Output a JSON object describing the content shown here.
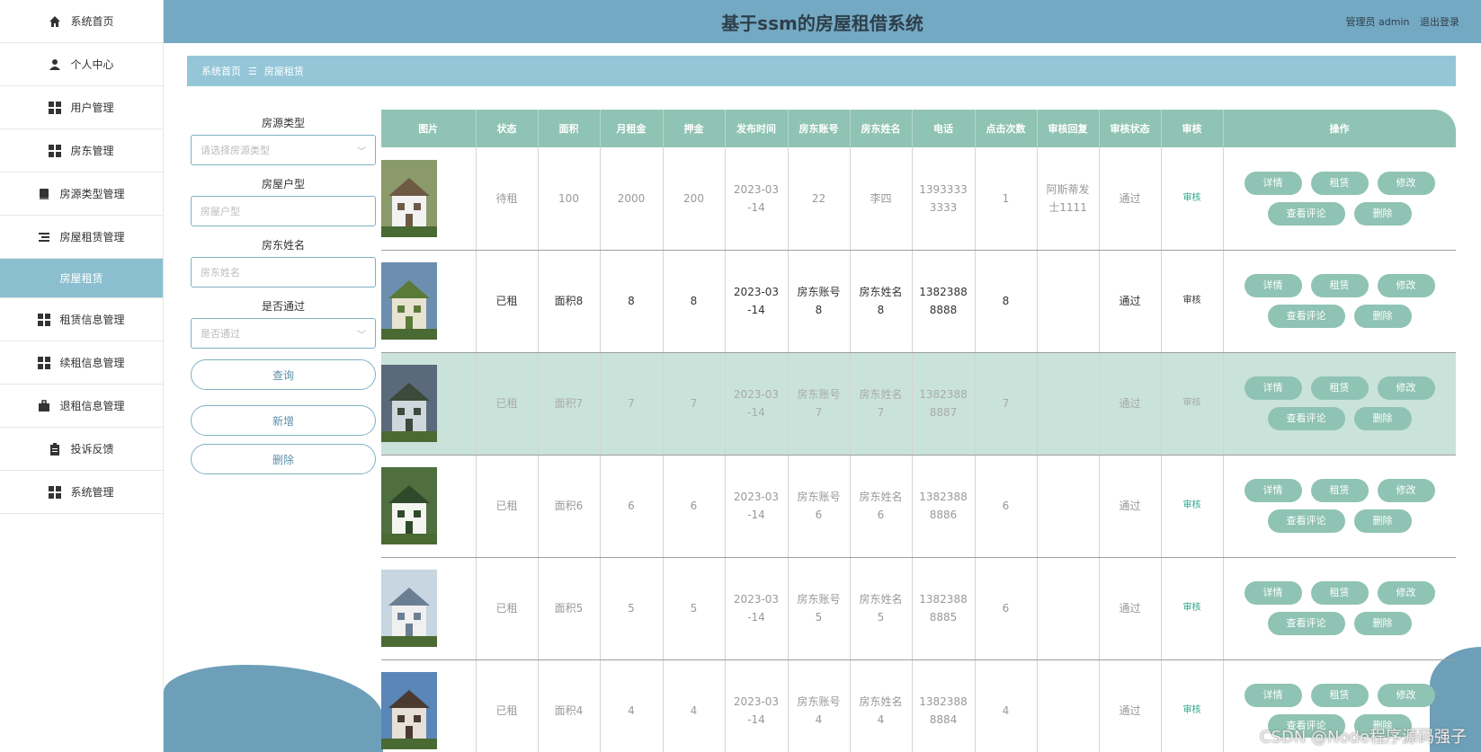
{
  "app": {
    "title": "基于ssm的房屋租借系统",
    "user_label": "管理员 admin",
    "logout": "退出登录"
  },
  "sidebar": {
    "items": [
      {
        "label": "系统首页",
        "icon": "home-icon"
      },
      {
        "label": "个人中心",
        "icon": "user-icon"
      },
      {
        "label": "用户管理",
        "icon": "grid-icon"
      },
      {
        "label": "房东管理",
        "icon": "grid-icon"
      },
      {
        "label": "房源类型管理",
        "icon": "book-icon"
      },
      {
        "label": "房屋租赁管理",
        "icon": "list-icon"
      },
      {
        "label": "房屋租赁",
        "icon": ""
      },
      {
        "label": "租赁信息管理",
        "icon": "grid-icon"
      },
      {
        "label": "续租信息管理",
        "icon": "grid-icon"
      },
      {
        "label": "退租信息管理",
        "icon": "briefcase-icon"
      },
      {
        "label": "投诉反馈",
        "icon": "clipboard-icon"
      },
      {
        "label": "系统管理",
        "icon": "grid-icon"
      }
    ]
  },
  "breadcrumb": {
    "home": "系统首页",
    "sep": "☰",
    "current": "房屋租赁"
  },
  "search": {
    "type_label": "房源类型",
    "type_placeholder": "请选择房源类型",
    "layout_label": "房屋户型",
    "layout_placeholder": "房屋户型",
    "landlord_label": "房东姓名",
    "landlord_placeholder": "房东姓名",
    "pass_label": "是否通过",
    "pass_placeholder": "是否通过",
    "query_btn": "查询",
    "add_btn": "新增",
    "delete_btn": "删除"
  },
  "table": {
    "headers": [
      "图片",
      "状态",
      "面积",
      "月租金",
      "押金",
      "发布时间",
      "房东账号",
      "房东姓名",
      "电话",
      "点击次数",
      "审核回复",
      "审核状态",
      "审核",
      "操作"
    ],
    "audit_link": "审核",
    "ops": {
      "detail": "详情",
      "rent": "租赁",
      "edit": "修改",
      "comments": "查看评论",
      "delete": "删除"
    },
    "rows": [
      {
        "status": "待租",
        "area": "100",
        "rent": "2000",
        "deposit": "200",
        "date_line1": "2023-03",
        "date_line2": "-14",
        "acct_line1": "22",
        "acct_line2": "",
        "name_line1": "李四",
        "name_line2": "",
        "phone_line1": "1393333",
        "phone_line2": "3333",
        "clicks": "1",
        "reply_line1": "阿斯蒂发",
        "reply_line2": "士1111",
        "audit_status": "通过"
      },
      {
        "status": "已租",
        "area": "面积8",
        "rent": "8",
        "deposit": "8",
        "date_line1": "2023-03",
        "date_line2": "-14",
        "acct_line1": "房东账号",
        "acct_line2": "8",
        "name_line1": "房东姓名",
        "name_line2": "8",
        "phone_line1": "1382388",
        "phone_line2": "8888",
        "clicks": "8",
        "reply_line1": "",
        "reply_line2": "",
        "audit_status": "通过"
      },
      {
        "status": "已租",
        "area": "面积7",
        "rent": "7",
        "deposit": "7",
        "date_line1": "2023-03",
        "date_line2": "-14",
        "acct_line1": "房东账号",
        "acct_line2": "7",
        "name_line1": "房东姓名",
        "name_line2": "7",
        "phone_line1": "1382388",
        "phone_line2": "8887",
        "clicks": "7",
        "reply_line1": "",
        "reply_line2": "",
        "audit_status": "通过"
      },
      {
        "status": "已租",
        "area": "面积6",
        "rent": "6",
        "deposit": "6",
        "date_line1": "2023-03",
        "date_line2": "-14",
        "acct_line1": "房东账号",
        "acct_line2": "6",
        "name_line1": "房东姓名",
        "name_line2": "6",
        "phone_line1": "1382388",
        "phone_line2": "8886",
        "clicks": "6",
        "reply_line1": "",
        "reply_line2": "",
        "audit_status": "通过"
      },
      {
        "status": "已租",
        "area": "面积5",
        "rent": "5",
        "deposit": "5",
        "date_line1": "2023-03",
        "date_line2": "-14",
        "acct_line1": "房东账号",
        "acct_line2": "5",
        "name_line1": "房东姓名",
        "name_line2": "5",
        "phone_line1": "1382388",
        "phone_line2": "8885",
        "clicks": "6",
        "reply_line1": "",
        "reply_line2": "",
        "audit_status": "通过"
      },
      {
        "status": "已租",
        "area": "面积4",
        "rent": "4",
        "deposit": "4",
        "date_line1": "2023-03",
        "date_line2": "-14",
        "acct_line1": "房东账号",
        "acct_line2": "4",
        "name_line1": "房东姓名",
        "name_line2": "4",
        "phone_line1": "1382388",
        "phone_line2": "8884",
        "clicks": "4",
        "reply_line1": "",
        "reply_line2": "",
        "audit_status": "通过"
      }
    ]
  },
  "watermark": "CSDN @Node程序源码强子",
  "colors": {
    "header": "#74a9c4",
    "breadcrumb": "#95c6d8",
    "table_head": "#8fc3b3",
    "highlight_row": "#c9e3da",
    "sidebar_active": "#8bbfcf"
  }
}
